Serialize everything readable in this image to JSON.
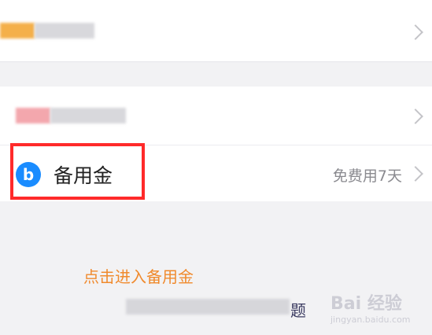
{
  "menu": {
    "reserve_fund": {
      "label": "备用金",
      "status": "免费用7天",
      "icon": "b-logo-icon",
      "icon_color": "#1a8cff"
    }
  },
  "caption": {
    "text": "点击进入备用金",
    "color": "#f08a2d"
  },
  "footer": {
    "visible_fragment": "题"
  },
  "watermark": {
    "text": "Bai 经验",
    "subtext": "jingyan.baidu.com"
  },
  "colors": {
    "highlight_box": "#ff2a2a"
  }
}
